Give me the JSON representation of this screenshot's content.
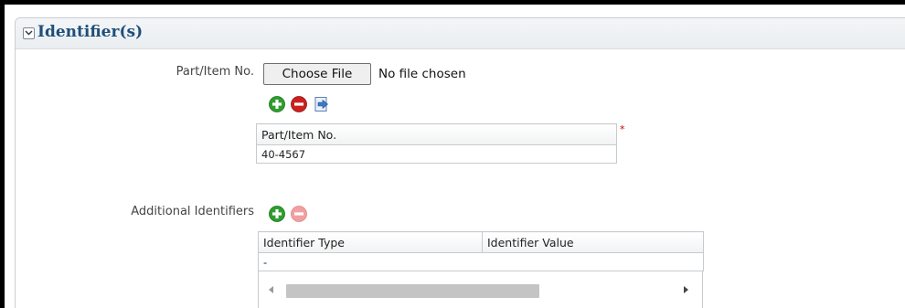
{
  "section": {
    "title": "Identifier(s)"
  },
  "part_item": {
    "label": "Part/Item No.",
    "file_button_label": "Choose File",
    "file_status": "No file chosen",
    "required_marker": "*",
    "table": {
      "columns": [
        "Part/Item No."
      ],
      "rows": [
        [
          "40-4567"
        ]
      ]
    }
  },
  "additional": {
    "label": "Additional Identifiers",
    "table": {
      "columns": [
        "Identifier Type",
        "Identifier Value"
      ],
      "rows": [
        [
          "-",
          ""
        ]
      ]
    }
  },
  "icons": {
    "add": "add-icon",
    "remove": "remove-icon",
    "import": "import-icon"
  },
  "colors": {
    "title": "#1f4e79",
    "add_green": "#2e9e2e",
    "remove_red": "#cc1f1f",
    "remove_disabled": "#f0a0a0"
  }
}
